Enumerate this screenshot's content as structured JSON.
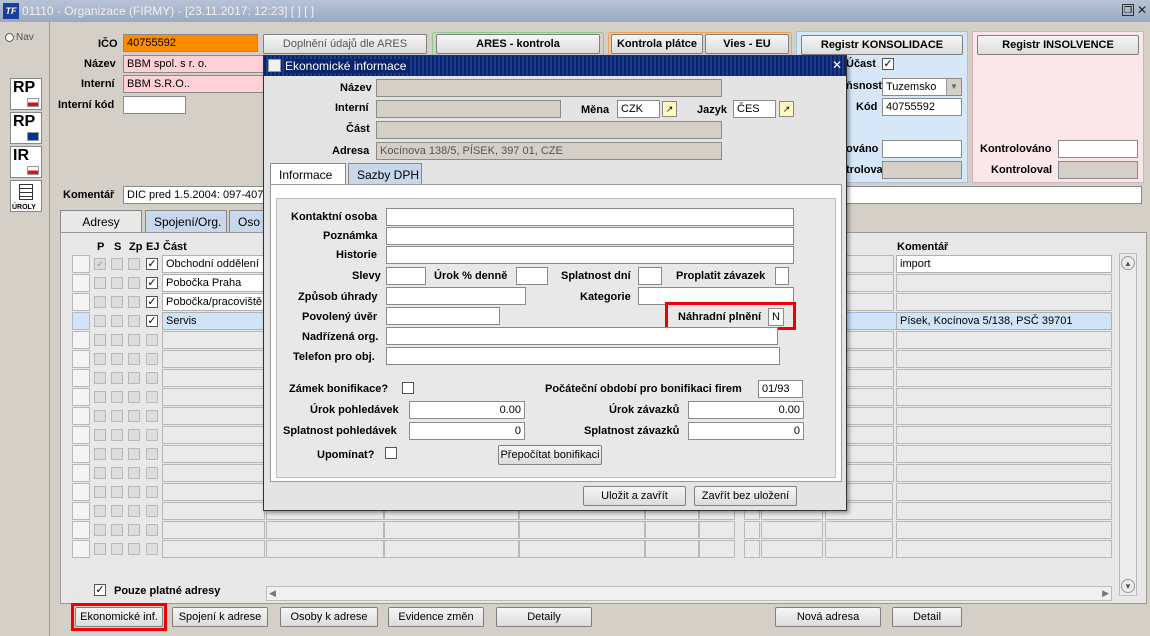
{
  "window": {
    "title": "01110 - Organizace (FIRMY) - [23.11.2017; 12:23]  [ ]  [ ]",
    "logo": "TF"
  },
  "nav": {
    "label": "Nav",
    "buttons": [
      "RP",
      "RP",
      "IR",
      "ÚROLY"
    ]
  },
  "company": {
    "ico_label": "IČO",
    "ico": "40755592",
    "nazev_label": "Název",
    "nazev": "BBM spol. s r. o.",
    "interni_label": "Interní",
    "interni": "BBM S.R.O..",
    "interni_kod_label": "Interní kód",
    "interni_kod": "",
    "komentar_label": "Komentář",
    "komentar": "DIC pred 1.5.2004: 097-4075"
  },
  "top_buttons": {
    "ares_doplneni": "Doplnění údajů dle ARES",
    "ares_kontrola": "ARES - kontrola",
    "kontrola_platce": "Kontrola plátce",
    "vies": "Vies - EU",
    "registr_konsolidace": "Registr KONSOLIDACE",
    "registr_insolvence": "Registr INSOLVENCE"
  },
  "konsolidace": {
    "ucast_label": "Účast",
    "ucast_checked": true,
    "pusobnost_label": "ňsnost",
    "pusobnost": "Tuzemsko",
    "kod_label": "Kód",
    "kod": "40755592",
    "kontrolovano_label": "ováno",
    "kontroloval_label": "troloval"
  },
  "insolvence": {
    "kontrolovano_label": "Kontrolováno",
    "kontroloval_label": "Kontroloval"
  },
  "main_tabs": [
    "Adresy",
    "Spojení/Org.",
    "Oso"
  ],
  "grid": {
    "headers": {
      "p": "P",
      "s": "S",
      "zp": "Zp",
      "ej": "EJ",
      "cast": "Část",
      "komentar": "Komentář"
    },
    "rows": [
      {
        "cast": "Obchodní oddělení",
        "komentar": "import"
      },
      {
        "cast": "Pobočka Praha",
        "komentar": ""
      },
      {
        "cast": "Pobočka/pracoviště",
        "komentar": ""
      },
      {
        "cast": "Servis",
        "komentar": "Písek, Kocínova 5/138, PSČ 39701"
      }
    ]
  },
  "pouze_platne": "Pouze platné adresy",
  "bottom_buttons": [
    "Ekonomické inf.",
    "Spojení k adrese",
    "Osoby k adrese",
    "Evidence změn",
    "Detaily",
    "Nová adresa",
    "Detail"
  ],
  "dialog": {
    "title": "Ekonomické informace",
    "nazev_label": "Název",
    "interni_label": "Interní",
    "mena_label": "Měna",
    "mena": "CZK",
    "jazyk_label": "Jazyk",
    "jazyk": "ČES",
    "cast_label": "Část",
    "adresa_label": "Adresa",
    "adresa": "Kocínova 138/5, PÍSEK, 397 01, CZE",
    "tabs": [
      "Informace",
      "Sazby DPH"
    ],
    "fields": {
      "kontaktni_osoba": "Kontaktní osoba",
      "poznamka": "Poznámka",
      "historie": "Historie",
      "slevy": "Slevy",
      "urok_denne": "Úrok % denně",
      "splatnost_dni": "Splatnost dní",
      "proplatit": "Proplatit závazek",
      "zpusob_uhrady": "Způsob úhrady",
      "kategorie": "Kategorie",
      "povoleny_uver": "Povolený úvěr",
      "nahradni_plneni": "Náhradní plnění",
      "nahradni_plneni_value": "N",
      "nadrizena_org": "Nadřízená org.",
      "telefon": "Telefon pro obj.",
      "zamek": "Zámek bonifikace?",
      "pocatecni": "Počáteční období pro bonifikaci firem",
      "pocatecni_value": "01/93",
      "urok_pohledavek": "Úrok pohledávek",
      "urok_pohledavek_value": "0.00",
      "urok_zavazku": "Úrok závazků",
      "urok_zavazku_value": "0.00",
      "splatnost_pohledavek": "Splatnost pohledávek",
      "splatnost_pohledavek_value": "0",
      "splatnost_zavazku": "Splatnost závazků",
      "splatnost_zavazku_value": "0",
      "upominat": "Upomínat?",
      "prepocitat": "Přepočítat bonifikaci"
    },
    "ulozit": "Uložit a zavřít",
    "zavrit": "Zavřít bez uložení"
  },
  "colors": {
    "title_bar": "#a6b4c9",
    "ico_bg": "#ff8c00",
    "pink": "#ffd0d8",
    "konsolidace_bg": "#d6e8f8",
    "insolvence_bg": "#fbe6ea",
    "highlight_row": "#cfe4f8",
    "dialog_title": "#0a246a",
    "red_box": "#e00000"
  }
}
